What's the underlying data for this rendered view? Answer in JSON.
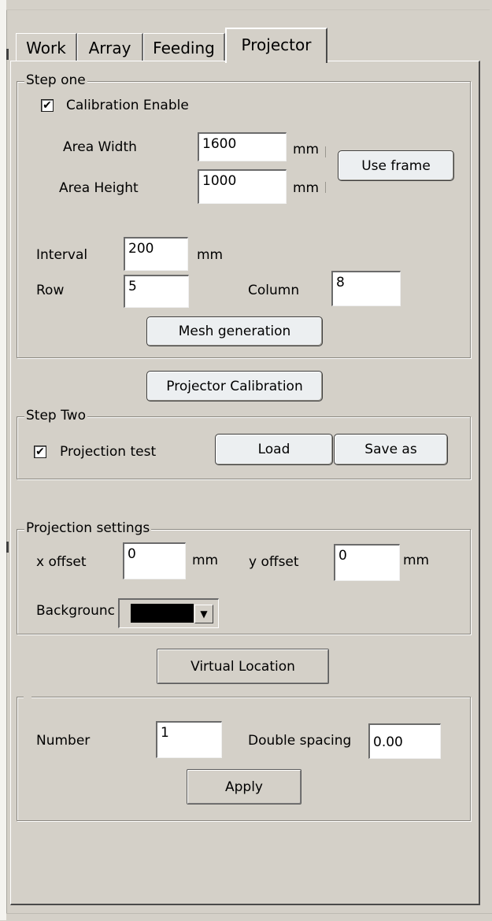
{
  "tabs": [
    {
      "label": "Work"
    },
    {
      "label": "Array"
    },
    {
      "label": "Feeding"
    },
    {
      "label": "Projector"
    }
  ],
  "step_one": {
    "legend": "Step one",
    "calibration_enable": {
      "label": "Calibration Enable",
      "checked": true,
      "check_glyph": "✔"
    },
    "area_width": {
      "label": "Area Width",
      "value": "1600",
      "unit": "mm"
    },
    "area_height": {
      "label": "Area Height",
      "value": "1000",
      "unit": "mm"
    },
    "use_frame_label": "Use frame",
    "interval": {
      "label": "Interval",
      "value": "200",
      "unit": "mm"
    },
    "row": {
      "label": "Row",
      "value": "5"
    },
    "column": {
      "label": "Column",
      "value": "8"
    },
    "mesh_generation_label": "Mesh generation"
  },
  "projector_calibration_label": "Projector Calibration",
  "step_two": {
    "legend": "Step Two",
    "projection_test": {
      "label": "Projection test",
      "checked": true,
      "check_glyph": "✔"
    },
    "load_label": "Load",
    "save_as_label": "Save as"
  },
  "projection_settings": {
    "legend": "Projection settings",
    "x_offset": {
      "label": "x offset",
      "value": "0",
      "unit": "mm"
    },
    "y_offset": {
      "label": "y offset",
      "value": "0",
      "unit": "mm"
    },
    "background": {
      "label": "Backgrounc",
      "color": "#000000",
      "arrow": "▼"
    }
  },
  "virtual_location_label": "Virtual Location",
  "array_group": {
    "number": {
      "label": "Number",
      "value": "1"
    },
    "double_spacing": {
      "label": "Double spacing",
      "value": "0.00"
    },
    "apply_label": "Apply"
  }
}
